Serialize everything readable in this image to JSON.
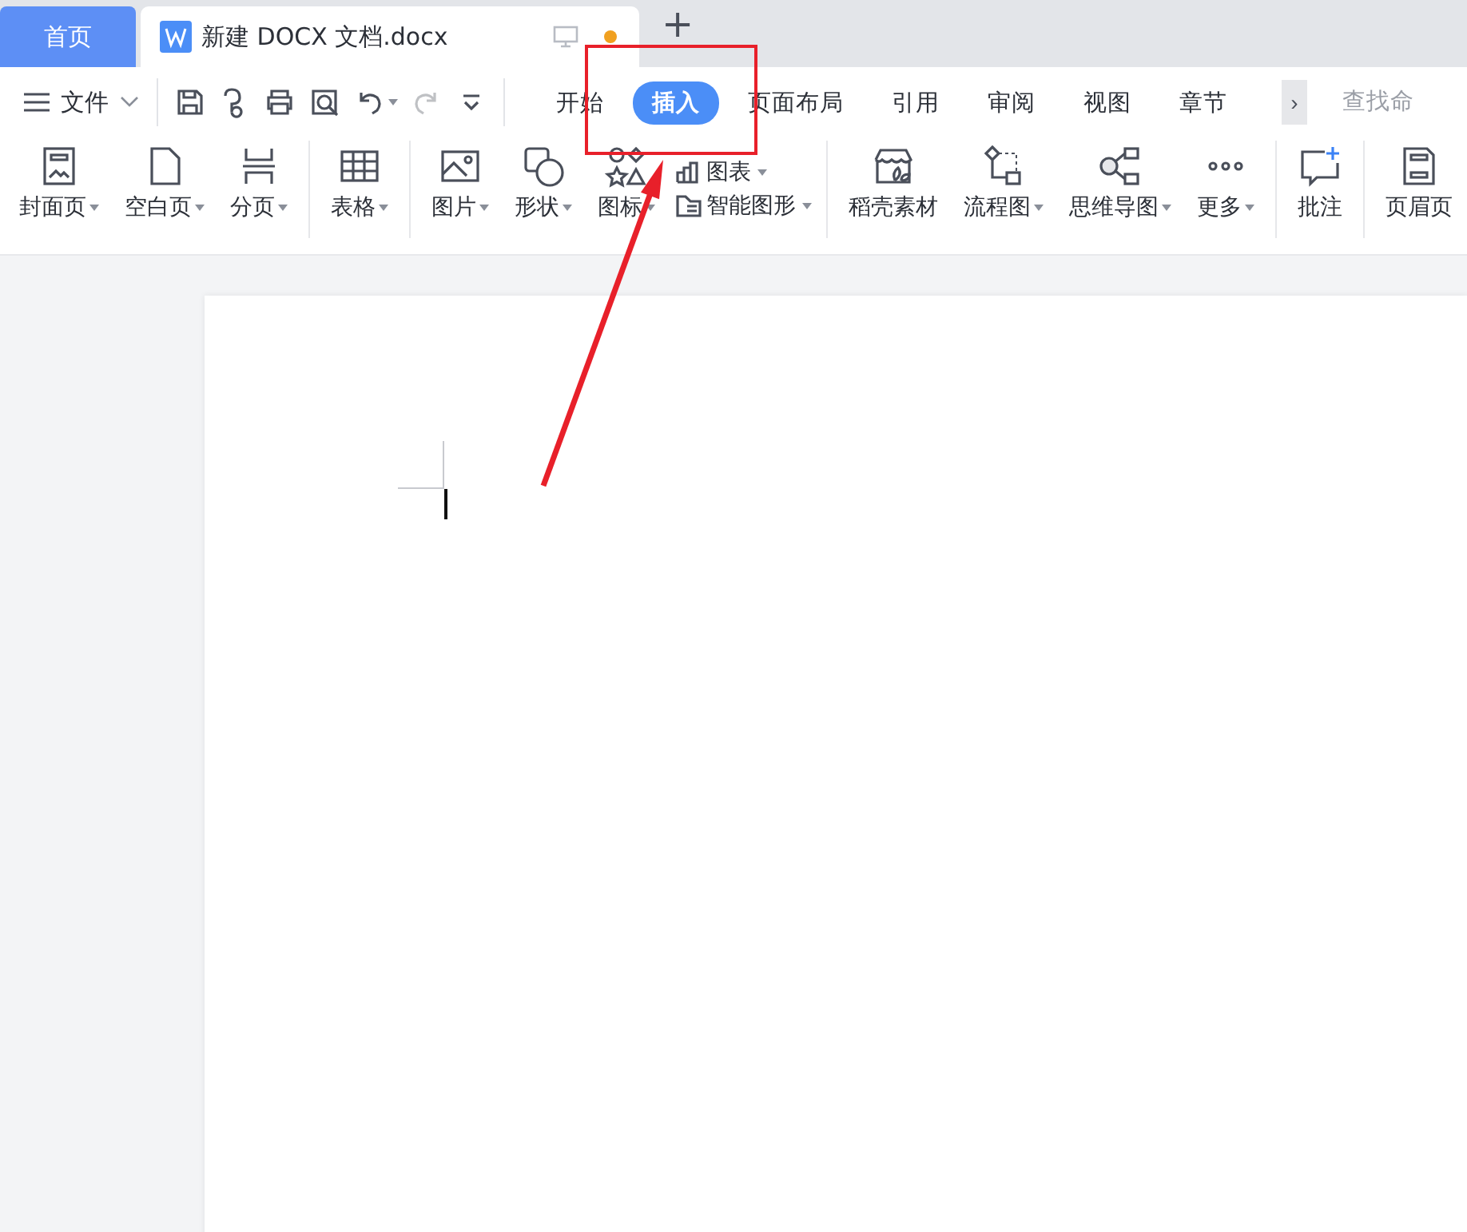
{
  "tabs": [
    {
      "label": "首页",
      "kind": "home",
      "selected": false
    },
    {
      "label": "新建 DOCX 文档.docx",
      "kind": "document",
      "selected": true,
      "modified": true
    }
  ],
  "new_tab_button": "+",
  "menu": {
    "label": "文件"
  },
  "quick_access": [
    {
      "disabled": false,
      "dropdown": false
    },
    {
      "disabled": false,
      "dropdown": false
    },
    {
      "disabled": false,
      "dropdown": false
    },
    {
      "disabled": false,
      "dropdown": false
    },
    {
      "disabled": false,
      "dropdown": true
    },
    {
      "disabled": true,
      "dropdown": false
    },
    {
      "disabled": false,
      "dropdown": false
    }
  ],
  "ribbon_tabs": [
    {
      "label": "开始",
      "selected": false
    },
    {
      "label": "插入",
      "selected": true
    },
    {
      "label": "页面布局",
      "selected": false
    },
    {
      "label": "引用",
      "selected": false
    },
    {
      "label": "审阅",
      "selected": false
    },
    {
      "label": "视图",
      "selected": false
    },
    {
      "label": "章节",
      "selected": false
    }
  ],
  "more_tabs_button": "›",
  "search": {
    "placeholder": "查找命"
  },
  "ribbon_groups": [
    {
      "items": [
        {
          "kind": "large",
          "label": "封面页",
          "dropdown": true
        },
        {
          "kind": "large",
          "label": "空白页",
          "dropdown": true
        },
        {
          "kind": "large",
          "label": "分页",
          "dropdown": true
        }
      ]
    },
    {
      "items": [
        {
          "kind": "large",
          "label": "表格",
          "dropdown": true
        }
      ]
    },
    {
      "items": [
        {
          "kind": "large",
          "label": "图片",
          "dropdown": true
        },
        {
          "kind": "large",
          "label": "形状",
          "dropdown": true
        },
        {
          "kind": "large",
          "label": "图标",
          "dropdown": true
        },
        {
          "kind": "stack",
          "items": [
            {
              "label": "图表",
              "dropdown": true
            },
            {
              "label": "智能图形",
              "dropdown": true
            }
          ]
        }
      ]
    },
    {
      "items": [
        {
          "kind": "large",
          "label": "稻壳素材",
          "dropdown": false
        },
        {
          "kind": "large",
          "label": "流程图",
          "dropdown": true
        },
        {
          "kind": "large",
          "label": "思维导图",
          "dropdown": true
        },
        {
          "kind": "large",
          "label": "更多",
          "dropdown": true
        }
      ]
    },
    {
      "items": [
        {
          "kind": "large",
          "label": "批注",
          "dropdown": false
        }
      ]
    },
    {
      "items": [
        {
          "kind": "large",
          "label": "页眉页",
          "dropdown": false
        }
      ]
    }
  ]
}
